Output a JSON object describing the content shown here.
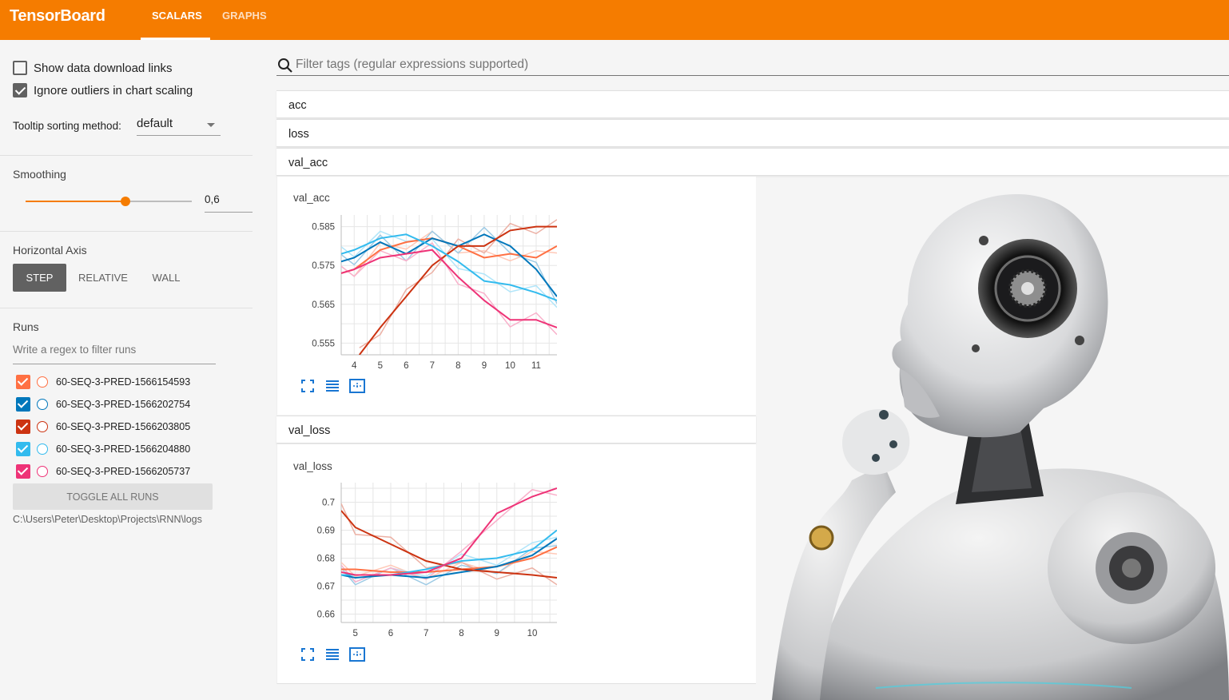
{
  "app": {
    "brand": "TensorBoard",
    "tabs": [
      {
        "label": "SCALARS",
        "active": true
      },
      {
        "label": "GRAPHS",
        "active": false
      }
    ],
    "accent": "#f57c00"
  },
  "sidebar": {
    "show_download_links": {
      "label": "Show data download links",
      "checked": false
    },
    "ignore_outliers": {
      "label": "Ignore outliers in chart scaling",
      "checked": true
    },
    "tooltip_sorting": {
      "label": "Tooltip sorting method:",
      "value": "default"
    },
    "smoothing": {
      "title": "Smoothing",
      "value": "0,6",
      "fraction": 0.6
    },
    "horizontal_axis": {
      "title": "Horizontal Axis",
      "options": [
        {
          "label": "STEP",
          "active": true
        },
        {
          "label": "RELATIVE",
          "active": false
        },
        {
          "label": "WALL",
          "active": false
        }
      ]
    },
    "runs": {
      "title": "Runs",
      "filter_placeholder": "Write a regex to filter runs",
      "items": [
        {
          "name": "60-SEQ-3-PRED-1566154593",
          "color": "#ff7043",
          "checked": true
        },
        {
          "name": "60-SEQ-3-PRED-1566202754",
          "color": "#0077bb",
          "checked": true
        },
        {
          "name": "60-SEQ-3-PRED-1566203805",
          "color": "#cc3311",
          "checked": true
        },
        {
          "name": "60-SEQ-3-PRED-1566204880",
          "color": "#33bbee",
          "checked": true
        },
        {
          "name": "60-SEQ-3-PRED-1566205737",
          "color": "#ee3377",
          "checked": true
        }
      ],
      "toggle_label": "TOGGLE ALL RUNS",
      "logdir": "C:\\Users\\Peter\\Desktop\\Projects\\RNN\\logs"
    }
  },
  "main": {
    "filter_placeholder": "Filter tags (regular expressions supported)",
    "groups": [
      "acc",
      "loss",
      "val_acc",
      "val_loss"
    ]
  },
  "chart_data": [
    {
      "type": "line",
      "title": "val_acc",
      "x_ticks": [
        "4",
        "5",
        "6",
        "7",
        "8",
        "9",
        "10",
        "11"
      ],
      "y_ticks": [
        "0.585",
        "0.575",
        "0.565",
        "0.555"
      ],
      "xlim": [
        3.5,
        11.8
      ],
      "ylim": [
        0.552,
        0.588
      ],
      "series": [
        {
          "name": "60-SEQ-3-PRED-1566154593",
          "color": "#ff7043",
          "x": [
            3.5,
            4,
            5,
            6,
            7,
            8,
            9,
            10,
            11,
            11.8
          ],
          "y": [
            0.573,
            0.574,
            0.579,
            0.581,
            0.582,
            0.58,
            0.577,
            0.578,
            0.577,
            0.58
          ]
        },
        {
          "name": "60-SEQ-3-PRED-1566202754",
          "color": "#0077bb",
          "x": [
            3.5,
            4,
            5,
            6,
            7,
            8,
            9,
            10,
            11,
            11.8
          ],
          "y": [
            0.576,
            0.577,
            0.581,
            0.578,
            0.582,
            0.58,
            0.583,
            0.58,
            0.574,
            0.567
          ]
        },
        {
          "name": "60-SEQ-3-PRED-1566203805",
          "color": "#cc3311",
          "x": [
            4.2,
            5,
            6,
            7,
            8,
            9,
            10,
            11,
            11.8
          ],
          "y": [
            0.552,
            0.559,
            0.567,
            0.575,
            0.58,
            0.58,
            0.584,
            0.585,
            0.585
          ]
        },
        {
          "name": "60-SEQ-3-PRED-1566204880",
          "color": "#33bbee",
          "x": [
            3.5,
            4,
            5,
            6,
            7,
            8,
            9,
            10,
            11,
            11.8
          ],
          "y": [
            0.578,
            0.579,
            0.582,
            0.583,
            0.58,
            0.576,
            0.571,
            0.57,
            0.568,
            0.566
          ]
        },
        {
          "name": "60-SEQ-3-PRED-1566205737",
          "color": "#ee3377",
          "x": [
            3.5,
            4,
            5,
            6,
            7,
            8,
            9,
            10,
            11,
            11.8
          ],
          "y": [
            0.573,
            0.574,
            0.577,
            0.578,
            0.579,
            0.572,
            0.566,
            0.561,
            0.561,
            0.559
          ]
        }
      ]
    },
    {
      "type": "line",
      "title": "val_loss",
      "x_ticks": [
        "5",
        "6",
        "7",
        "8",
        "9",
        "10"
      ],
      "y_ticks": [
        "0.7",
        "0.69",
        "0.68",
        "0.67",
        "0.66"
      ],
      "xlim": [
        4.6,
        10.7
      ],
      "ylim": [
        0.657,
        0.707
      ],
      "series": [
        {
          "name": "60-SEQ-3-PRED-1566154593",
          "color": "#ff7043",
          "x": [
            4.6,
            5,
            6,
            7,
            8,
            9,
            10,
            10.7
          ],
          "y": [
            0.676,
            0.676,
            0.675,
            0.675,
            0.676,
            0.677,
            0.68,
            0.684
          ]
        },
        {
          "name": "60-SEQ-3-PRED-1566202754",
          "color": "#0077bb",
          "x": [
            4.6,
            5,
            6,
            7,
            8,
            9,
            10,
            10.7
          ],
          "y": [
            0.674,
            0.673,
            0.674,
            0.673,
            0.675,
            0.677,
            0.681,
            0.687
          ]
        },
        {
          "name": "60-SEQ-3-PRED-1566203805",
          "color": "#cc3311",
          "x": [
            4.6,
            5,
            6,
            7,
            8,
            9,
            10,
            10.7
          ],
          "y": [
            0.697,
            0.691,
            0.685,
            0.679,
            0.676,
            0.675,
            0.674,
            0.673
          ]
        },
        {
          "name": "60-SEQ-3-PRED-1566204880",
          "color": "#33bbee",
          "x": [
            4.6,
            5,
            6,
            7,
            8,
            9,
            10,
            10.7
          ],
          "y": [
            0.674,
            0.674,
            0.674,
            0.676,
            0.679,
            0.68,
            0.683,
            0.69
          ]
        },
        {
          "name": "60-SEQ-3-PRED-1566205737",
          "color": "#ee3377",
          "x": [
            4.6,
            5,
            6,
            7,
            8,
            9,
            10,
            10.7
          ],
          "y": [
            0.675,
            0.674,
            0.674,
            0.675,
            0.68,
            0.696,
            0.702,
            0.705
          ]
        }
      ]
    }
  ]
}
